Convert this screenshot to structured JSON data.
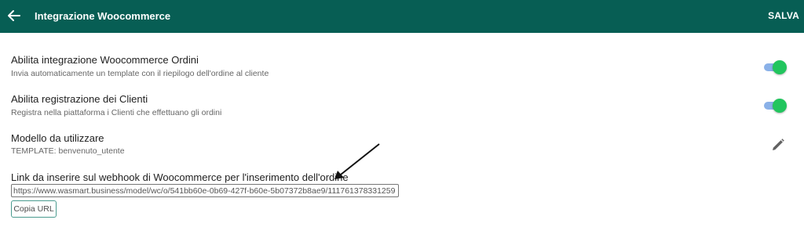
{
  "header": {
    "title": "Integrazione Woocommerce",
    "save_label": "SALVA",
    "back_icon": "arrow-left-icon"
  },
  "settings": {
    "orders": {
      "label": "Abilita integrazione Woocommerce Ordini",
      "description": "Invia automaticamente un template con il riepilogo dell'ordine al cliente",
      "enabled": true
    },
    "customers": {
      "label": "Abilita registrazione dei Clienti",
      "description": "Registra nella piattaforma i Clienti che effettuano gli ordini",
      "enabled": true
    },
    "template": {
      "label": "Modello da utilizzare",
      "value": "TEMPLATE: benvenuto_utente",
      "edit_icon": "pencil-icon"
    },
    "webhook": {
      "label": "Link da inserire sul webhook di Woocommerce per l'inserimento dell'ordine",
      "url": "https://www.wasmart.business/model/wc/o/541bb60e-0b69-427f-b60e-5b07372b8ae9/111761378331259",
      "copy_label": "Copia URL"
    }
  },
  "colors": {
    "header_bg": "#075e54",
    "toggle_thumb": "#22c55e",
    "toggle_track": "#8ab1e8"
  }
}
